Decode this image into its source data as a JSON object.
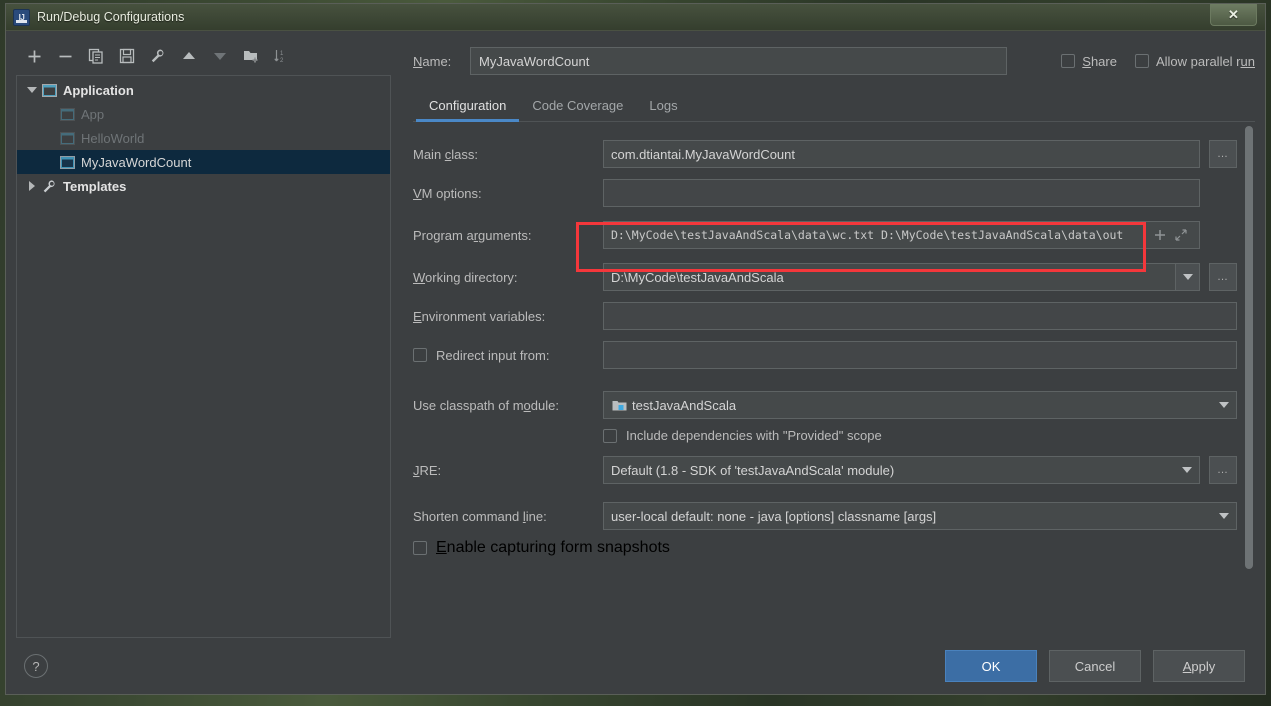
{
  "window": {
    "title": "Run/Debug Configurations",
    "app_icon": "intellij-idea-icon",
    "close_label": "✕"
  },
  "toolbar": {
    "buttons": [
      {
        "name": "add-configuration",
        "icon": "plus-icon"
      },
      {
        "name": "remove-configuration",
        "icon": "minus-icon"
      },
      {
        "name": "copy-configuration",
        "icon": "copy-icon"
      },
      {
        "name": "save-configuration",
        "icon": "save-icon"
      },
      {
        "name": "edit-templates",
        "icon": "wrench-icon"
      },
      {
        "name": "move-up",
        "icon": "arrow-up-icon"
      },
      {
        "name": "move-down",
        "icon": "arrow-down-icon"
      },
      {
        "name": "create-folder",
        "icon": "folder-add-icon"
      },
      {
        "name": "sort-configurations",
        "icon": "sort-icon"
      }
    ]
  },
  "tree": {
    "nodes": [
      {
        "label": "Application",
        "type": "group",
        "expanded": true,
        "icon": "application-icon"
      },
      {
        "label": "App",
        "type": "child",
        "dim": true,
        "icon": "application-icon"
      },
      {
        "label": "HelloWorld",
        "type": "child",
        "dim": true,
        "icon": "application-icon"
      },
      {
        "label": "MyJavaWordCount",
        "type": "child",
        "selected": true,
        "icon": "application-icon"
      },
      {
        "label": "Templates",
        "type": "group",
        "expanded": false,
        "icon": "wrench-icon"
      }
    ]
  },
  "header": {
    "name_label": "Name:",
    "name_mnemonic": "N",
    "name_value": "MyJavaWordCount",
    "share_label": "Share",
    "share_mnemonic": "S",
    "share_checked": false,
    "parallel_label": "Allow parallel run",
    "parallel_checked": false
  },
  "tabs": [
    {
      "label": "Configuration",
      "active": true
    },
    {
      "label": "Code Coverage",
      "active": false
    },
    {
      "label": "Logs",
      "active": false
    }
  ],
  "form": {
    "main_class": {
      "label_pre": "Main ",
      "label_mn": "c",
      "label_post": "lass:",
      "value": "com.dtiantai.MyJavaWordCount",
      "browse_label": "...'"
    },
    "vm_options": {
      "label_mn": "V",
      "label_post": "M options:",
      "value": "",
      "macro_icon": "plus-icon",
      "expand_icon": "expand-icon"
    },
    "program_arguments": {
      "label_pre": "Program a",
      "label_mn": "r",
      "label_post": "guments:",
      "value": "D:\\MyCode\\testJavaAndScala\\data\\wc.txt D:\\MyCode\\testJavaAndScala\\data\\out",
      "macro_icon": "plus-icon",
      "expand_icon": "expand-icon",
      "highlighted": true,
      "highlight_color": "#f4373b"
    },
    "working_directory": {
      "label_mn": "W",
      "label_post": "orking directory:",
      "value": "D:\\MyCode\\testJavaAndScala",
      "browse_label": "...'"
    },
    "environment_variables": {
      "label_mn": "E",
      "label_post": "nvironment variables:",
      "value": "",
      "browse_icon": "list-icon"
    },
    "redirect_input": {
      "label_pre": "Redirect input from:",
      "checked": false,
      "value": "",
      "browse_icon": "folder-icon"
    },
    "classpath_module": {
      "label_pre": "Use classpath of m",
      "label_mn": "o",
      "label_post": "dule:",
      "value": "testJavaAndScala",
      "value_icon": "module-icon"
    },
    "include_provided": {
      "label": "Include dependencies with \"Provided\" scope",
      "checked": false
    },
    "jre": {
      "label_mn": "J",
      "label_post": "RE:",
      "value": "Default (1.8 - SDK of 'testJavaAndScala' module)",
      "browse_label": "...'"
    },
    "shorten_command_line": {
      "label_pre": "Shorten command ",
      "label_mn": "l",
      "label_post": "ine:",
      "value": "user-local default: none - java [options] classname [args]"
    },
    "form_snapshots": {
      "label_mn": "E",
      "label_post": "nable capturing form snapshots",
      "checked": false
    }
  },
  "footer": {
    "help_label": "?",
    "ok_label": "OK",
    "cancel_label": "Cancel",
    "apply_pre": "A",
    "apply_mn": "p",
    "apply_post": "ply",
    "apply_label": "Apply",
    "ok_color": "#3c6ea5"
  }
}
